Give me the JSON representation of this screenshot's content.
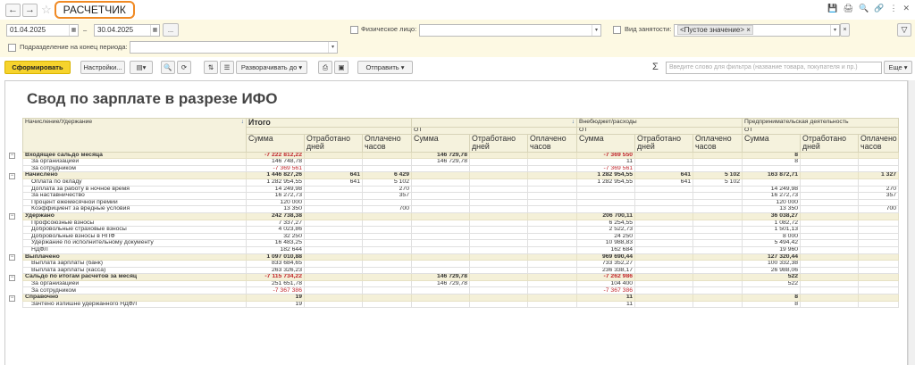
{
  "header": {
    "title": "РАСЧЕТЧИК",
    "back": "←",
    "forward": "→",
    "star": "☆",
    "icons": [
      "💾",
      "🖨",
      "🔍",
      "🔗",
      "⋮",
      "✕"
    ]
  },
  "filters": {
    "period_from": "01.04.2025",
    "period_to": "30.04.2025",
    "dash": "–",
    "ellipsis": "...",
    "phys_label": "Физическое лицо:",
    "vid_label": "Вид занятости:",
    "vid_value": "<Пустое значение>",
    "vid_clear": "×",
    "dots": "·",
    "x": "×",
    "podr_label": "Подразделение на конец периода:",
    "filter_icon": "▽"
  },
  "toolbar": {
    "form": "Сформировать",
    "settings": "Настройки...",
    "expand": "Разворачивать до",
    "send": "Отправить",
    "sigma": "Σ",
    "search_placeholder": "Введите слово для фильтра (название товара, покупателя и пр.)",
    "more": "Еще",
    "dd": "▾"
  },
  "report": {
    "title": "Свод по зарплате в разрезе ИФО",
    "col_head": "Начисление/Удержание",
    "total": "Итого",
    "ot": "ОТ",
    "vnebudget": "Внебюджет/расходы",
    "predpr": "Предпринимательская деятельность",
    "sort": "↓",
    "sub": [
      "Сумма",
      "Отработано дней",
      "Оплачено часов"
    ],
    "rows": [
      {
        "g": 1,
        "label": "Входящее сальдо месяца",
        "v": [
          "-7 222 812,22",
          "",
          "",
          "146 729,78",
          "",
          "",
          "-7 369 550",
          "",
          "",
          "8",
          "",
          ""
        ]
      },
      {
        "g": 0,
        "label": "За организацией",
        "v": [
          "146 748,78",
          "",
          "",
          "146 729,78",
          "",
          "",
          "11",
          "",
          "",
          "8",
          "",
          ""
        ]
      },
      {
        "g": 0,
        "label": "За сотрудником",
        "v": [
          "-7 369 561",
          "",
          "",
          "",
          "",
          "",
          "-7 369 561",
          "",
          "",
          "",
          "",
          ""
        ]
      },
      {
        "g": 1,
        "label": "Начислено",
        "v": [
          "1 446 827,26",
          "641",
          "6 429",
          "",
          "",
          "",
          "1 282 954,55",
          "641",
          "5 102",
          "163 872,71",
          "",
          "1 327"
        ]
      },
      {
        "g": 0,
        "label": "Оплата по окладу",
        "v": [
          "1 282 954,55",
          "641",
          "5 102",
          "",
          "",
          "",
          "1 282 954,55",
          "641",
          "5 102",
          "",
          "",
          ""
        ]
      },
      {
        "g": 0,
        "label": "Доплата за работу в ночное время",
        "v": [
          "14 249,98",
          "",
          "270",
          "",
          "",
          "",
          "",
          "",
          "",
          "14 249,98",
          "",
          "270"
        ]
      },
      {
        "g": 0,
        "label": "За наставничество",
        "v": [
          "16 272,73",
          "",
          "357",
          "",
          "",
          "",
          "",
          "",
          "",
          "16 272,73",
          "",
          "357"
        ]
      },
      {
        "g": 0,
        "label": "Процент ежемесячной премии",
        "v": [
          "120 000",
          "",
          "",
          "",
          "",
          "",
          "",
          "",
          "",
          "120 000",
          "",
          ""
        ]
      },
      {
        "g": 0,
        "label": "Коэффициент за вредные условия",
        "v": [
          "13 350",
          "",
          "700",
          "",
          "",
          "",
          "",
          "",
          "",
          "13 350",
          "",
          "700"
        ]
      },
      {
        "g": 1,
        "label": "Удержано",
        "v": [
          "242 738,38",
          "",
          "",
          "",
          "",
          "",
          "206 700,11",
          "",
          "",
          "36 038,27",
          "",
          ""
        ]
      },
      {
        "g": 0,
        "label": "Профсоюзные взносы",
        "v": [
          "7 337,27",
          "",
          "",
          "",
          "",
          "",
          "6 254,55",
          "",
          "",
          "1 082,72",
          "",
          ""
        ]
      },
      {
        "g": 0,
        "label": "Добровольные страховые взносы",
        "v": [
          "4 023,86",
          "",
          "",
          "",
          "",
          "",
          "2 522,73",
          "",
          "",
          "1 501,13",
          "",
          ""
        ]
      },
      {
        "g": 0,
        "label": "Добровольные взносы в НПФ",
        "v": [
          "32 250",
          "",
          "",
          "",
          "",
          "",
          "24 250",
          "",
          "",
          "8 000",
          "",
          ""
        ]
      },
      {
        "g": 0,
        "label": "Удержание по исполнительному документу",
        "v": [
          "16 483,25",
          "",
          "",
          "",
          "",
          "",
          "10 988,83",
          "",
          "",
          "5 494,42",
          "",
          ""
        ]
      },
      {
        "g": 0,
        "label": "НДФЛ",
        "v": [
          "182 644",
          "",
          "",
          "",
          "",
          "",
          "162 684",
          "",
          "",
          "19 960",
          "",
          ""
        ]
      },
      {
        "g": 1,
        "label": "Выплачено",
        "v": [
          "1 097 010,88",
          "",
          "",
          "",
          "",
          "",
          "969 690,44",
          "",
          "",
          "127 320,44",
          "",
          ""
        ]
      },
      {
        "g": 0,
        "label": "Выплата зарплаты (банк)",
        "v": [
          "833 684,65",
          "",
          "",
          "",
          "",
          "",
          "733 352,27",
          "",
          "",
          "100 332,38",
          "",
          ""
        ]
      },
      {
        "g": 0,
        "label": "Выплата зарплаты (касса)",
        "v": [
          "263 326,23",
          "",
          "",
          "",
          "",
          "",
          "236 338,17",
          "",
          "",
          "26 988,06",
          "",
          ""
        ]
      },
      {
        "g": 1,
        "label": "Сальдо по итогам расчетов за месяц",
        "v": [
          "-7 115 734,22",
          "",
          "",
          "146 729,78",
          "",
          "",
          "-7 262 986",
          "",
          "",
          "522",
          "",
          ""
        ]
      },
      {
        "g": 0,
        "label": "За организацией",
        "v": [
          "251 651,78",
          "",
          "",
          "146 729,78",
          "",
          "",
          "104 400",
          "",
          "",
          "522",
          "",
          ""
        ]
      },
      {
        "g": 0,
        "label": "За сотрудником",
        "v": [
          "-7 367 386",
          "",
          "",
          "",
          "",
          "",
          "-7 367 386",
          "",
          "",
          "",
          "",
          ""
        ]
      },
      {
        "g": 1,
        "label": "Справочно",
        "v": [
          "19",
          "",
          "",
          "",
          "",
          "",
          "11",
          "",
          "",
          "8",
          "",
          ""
        ]
      },
      {
        "g": 0,
        "label": "Зачтено излишне удержанного НДФЛ",
        "v": [
          "19",
          "",
          "",
          "",
          "",
          "",
          "11",
          "",
          "",
          "8",
          "",
          ""
        ]
      }
    ]
  }
}
